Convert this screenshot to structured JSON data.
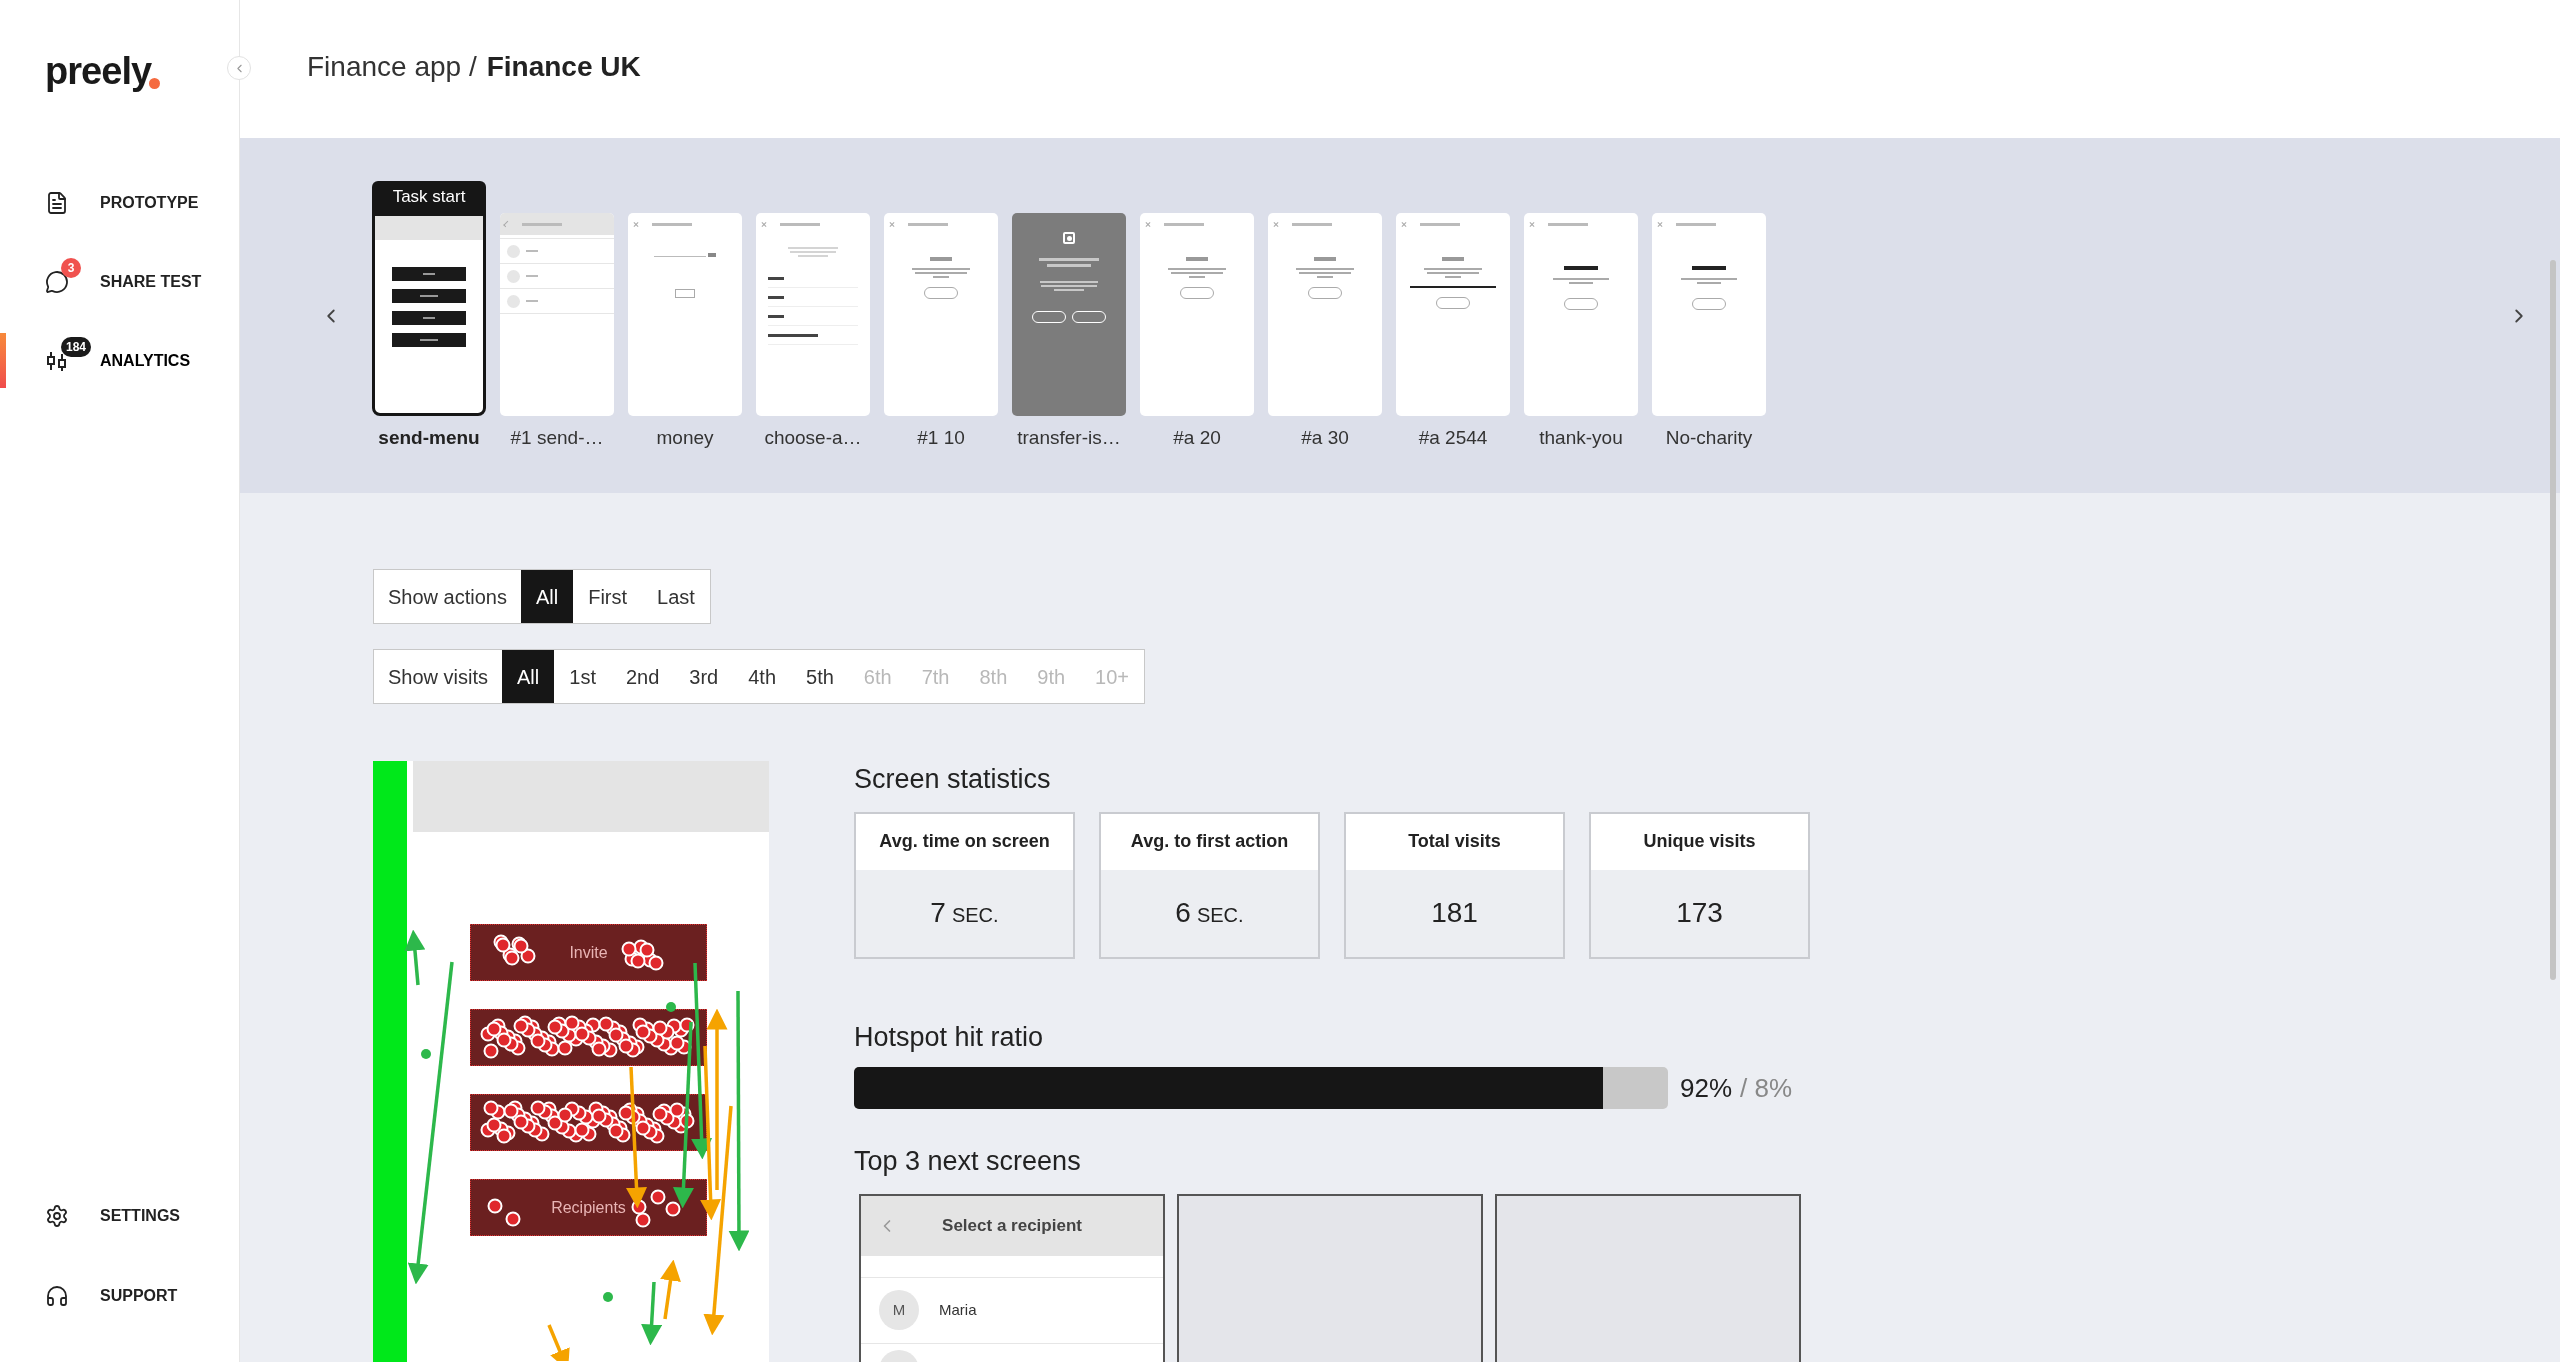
{
  "sidebar": {
    "logo": "preely",
    "nav": [
      {
        "label": "PROTOTYPE",
        "selected": false
      },
      {
        "label": "SHARE TEST",
        "selected": false,
        "badge": {
          "text": "3",
          "color": "#f0524f"
        }
      },
      {
        "label": "ANALYTICS",
        "selected": true,
        "badge": {
          "text": "184",
          "color": "#1a1a1a"
        }
      }
    ],
    "footer": [
      {
        "label": "SETTINGS"
      },
      {
        "label": "SUPPORT"
      }
    ]
  },
  "breadcrumb": {
    "parent": "Finance app /",
    "current": "Finance UK"
  },
  "screens": [
    {
      "label": "send-menu",
      "selected": true,
      "badge": "Task start",
      "kind": "menu"
    },
    {
      "label": "#1 send-…",
      "selected": false,
      "kind": "list"
    },
    {
      "label": "money",
      "selected": false,
      "kind": "input"
    },
    {
      "label": "choose-a…",
      "selected": false,
      "kind": "amounts"
    },
    {
      "label": "#1 10",
      "selected": false,
      "kind": "confirm"
    },
    {
      "label": "transfer-is…",
      "selected": false,
      "kind": "dark"
    },
    {
      "label": "#a 20",
      "selected": false,
      "kind": "confirm"
    },
    {
      "label": "#a 30",
      "selected": false,
      "kind": "confirm"
    },
    {
      "label": "#a 2544",
      "selected": false,
      "kind": "confirm_note"
    },
    {
      "label": "thank-you",
      "selected": false,
      "kind": "thanks"
    },
    {
      "label": "No-charity",
      "selected": false,
      "kind": "thanks"
    }
  ],
  "filters": [
    {
      "label": "Show actions",
      "options": [
        {
          "label": "All",
          "selected": true
        },
        {
          "label": "First",
          "selected": false
        },
        {
          "label": "Last",
          "selected": false
        }
      ]
    },
    {
      "label": "Show visits",
      "options": [
        {
          "label": "All",
          "selected": true,
          "disabled": false
        },
        {
          "label": "1st",
          "selected": false,
          "disabled": false
        },
        {
          "label": "2nd",
          "selected": false,
          "disabled": false
        },
        {
          "label": "3rd",
          "selected": false,
          "disabled": false
        },
        {
          "label": "4th",
          "selected": false,
          "disabled": false
        },
        {
          "label": "5th",
          "selected": false,
          "disabled": false
        },
        {
          "label": "6th",
          "selected": false,
          "disabled": true
        },
        {
          "label": "7th",
          "selected": false,
          "disabled": true
        },
        {
          "label": "8th",
          "selected": false,
          "disabled": true
        },
        {
          "label": "9th",
          "selected": false,
          "disabled": true
        },
        {
          "label": "10+",
          "selected": false,
          "disabled": true
        }
      ]
    }
  ],
  "heatmap": {
    "buttons": [
      "Invite",
      "Recipients"
    ]
  },
  "statistics": {
    "title": "Screen statistics",
    "cards": [
      {
        "title": "Avg. time on screen",
        "value": "7",
        "unit": "SEC."
      },
      {
        "title": "Avg. to first action",
        "value": "6",
        "unit": "SEC."
      },
      {
        "title": "Total visits",
        "value": "181"
      },
      {
        "title": "Unique visits",
        "value": "173"
      }
    ]
  },
  "hotspot": {
    "title": "Hotspot hit ratio",
    "level": 0.92,
    "hit": "92%",
    "miss": "/ 8%"
  },
  "next_screens": {
    "title": "Top 3 next screens",
    "screens": [
      {
        "kind": "list",
        "title": "Select a recipient",
        "items": [
          {
            "initial": "M",
            "name": "Maria"
          }
        ]
      },
      {
        "kind": "empty"
      },
      {
        "kind": "empty"
      }
    ]
  }
}
